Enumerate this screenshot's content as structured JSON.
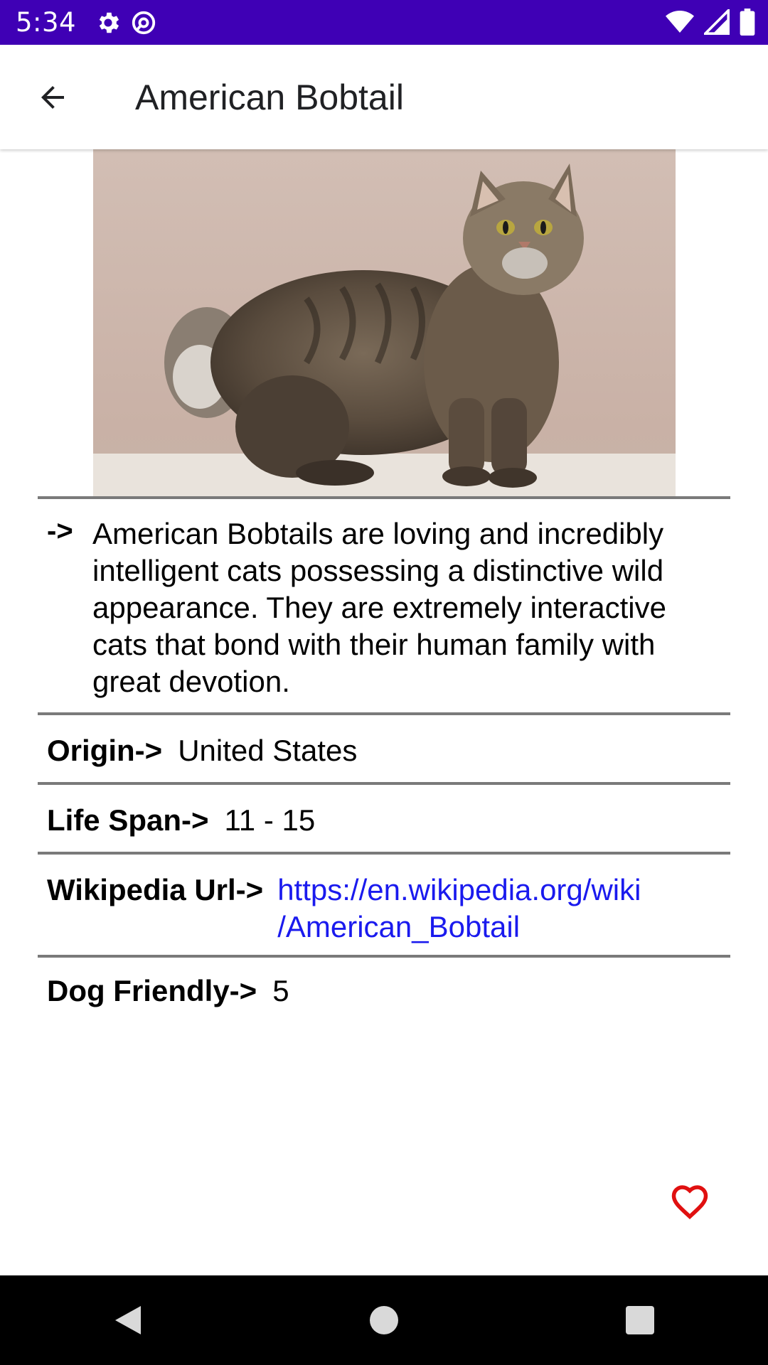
{
  "status_bar": {
    "time": "5:34",
    "icons": [
      "settings-icon",
      "vpn-icon",
      "wifi-icon",
      "cellular-icon",
      "battery-icon"
    ],
    "background": "#3f00b5"
  },
  "app_bar": {
    "title": "American Bobtail",
    "back_icon": "arrow-back-icon"
  },
  "breed": {
    "image_alt": "American Bobtail cat photo",
    "description_prefix": "->",
    "description": "American Bobtails are loving and incredibly intelligent cats possessing a distinctive wild appearance. They are extremely interactive cats that bond with their human family with great devotion.",
    "origin_label": "Origin->",
    "origin": "United States",
    "life_span_label": "Life Span->",
    "life_span": "11 - 15",
    "wikipedia_label": "Wikipedia Url->",
    "wikipedia_url_line1": "https://en.wikipedia.org/wiki",
    "wikipedia_url_line2": "/American_Bobtail",
    "dog_friendly_label": "Dog Friendly->",
    "dog_friendly": "5"
  },
  "favorite": {
    "icon": "heart-outline-icon",
    "color": "#e01010"
  },
  "nav_bar": {
    "buttons": [
      "back-triangle-icon",
      "home-circle-icon",
      "recents-square-icon"
    ]
  }
}
